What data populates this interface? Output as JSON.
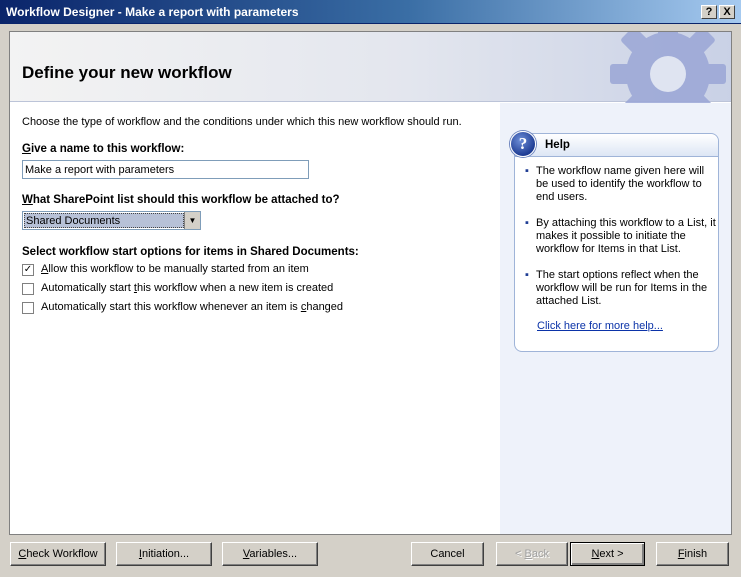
{
  "window": {
    "title": "Workflow Designer - Make a report with parameters",
    "help_btn": "?",
    "close_btn": "X"
  },
  "header": {
    "title": "Define your new workflow"
  },
  "form": {
    "intro": "Choose the type of workflow and the conditions under which this new workflow should run.",
    "name_label_u": "G",
    "name_label_rest": "ive a name to this workflow:",
    "name_value": "Make a report with parameters",
    "list_label_u": "W",
    "list_label_rest": "hat SharePoint list should this workflow be attached to?",
    "list_selected": "Shared Documents",
    "start_label": "Select workflow start options for items in Shared Documents:",
    "options": [
      {
        "checked": true,
        "pre": "",
        "u": "A",
        "post": "llow this workflow to be manually started from an item"
      },
      {
        "checked": false,
        "pre": "Automatically start ",
        "u": "t",
        "post": "his workflow when a new item is created"
      },
      {
        "checked": false,
        "pre": "Automatically start this workflow whenever an item is ",
        "u": "c",
        "post": "hanged"
      }
    ]
  },
  "help": {
    "title": "Help",
    "icon": "question-icon",
    "items": [
      "The workflow name given here will be used to identify the workflow to end users.",
      "By attaching this workflow to a List, it makes it possible to initiate the workflow for Items in that List.",
      "The start options reflect when the workflow will be run for Items in the attached List."
    ],
    "link": "Click here for more help..."
  },
  "buttons": {
    "check": {
      "u": "C",
      "rest": "heck Workflow"
    },
    "initiation": {
      "u": "I",
      "rest": "nitiation..."
    },
    "variables": {
      "u": "V",
      "rest": "ariables..."
    },
    "cancel": "Cancel",
    "back": {
      "pre": "< ",
      "u": "B",
      "rest": "ack"
    },
    "next": {
      "u": "N",
      "rest": "ext >"
    },
    "finish": {
      "u": "F",
      "rest": "inish"
    }
  }
}
